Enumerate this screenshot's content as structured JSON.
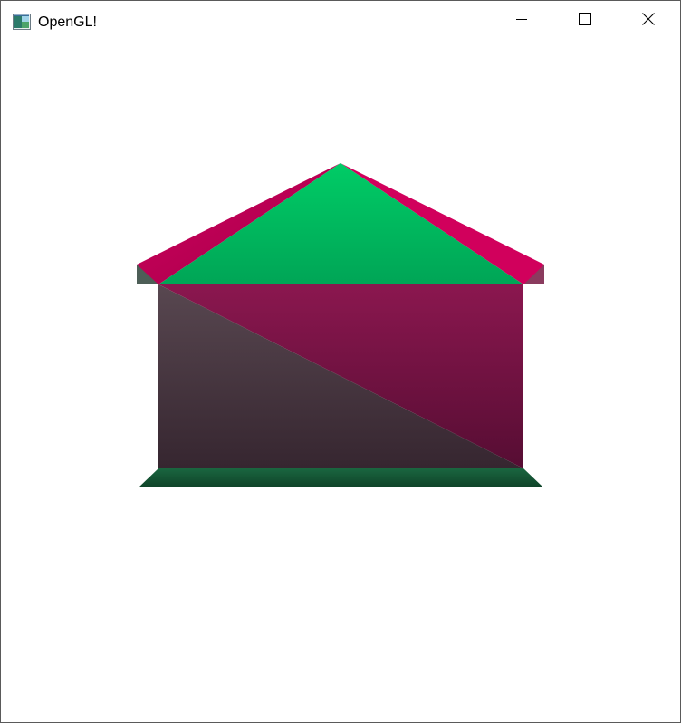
{
  "window": {
    "title": "OpenGL!",
    "app_icon": "opengl-window-icon",
    "controls": {
      "minimize_icon": "minimize-icon",
      "maximize_icon": "maximize-icon",
      "close_icon": "close-icon"
    }
  },
  "scene": {
    "clear_color": "#ffffff",
    "colors": {
      "roof_front_top": "#00cc66",
      "roof_front_bottom": "#00a556",
      "roof_side": "#d1005c",
      "roof_side_dark": "#a3004a",
      "roof_edge": "#4d5e57",
      "wall_upper_right_top": "#8b174f",
      "wall_upper_right_bottom": "#560d33",
      "wall_lower_left_top": "#584750",
      "wall_lower_left_bottom": "#362630",
      "base_top": "#1a6640",
      "base_bottom": "#0f4328"
    }
  }
}
